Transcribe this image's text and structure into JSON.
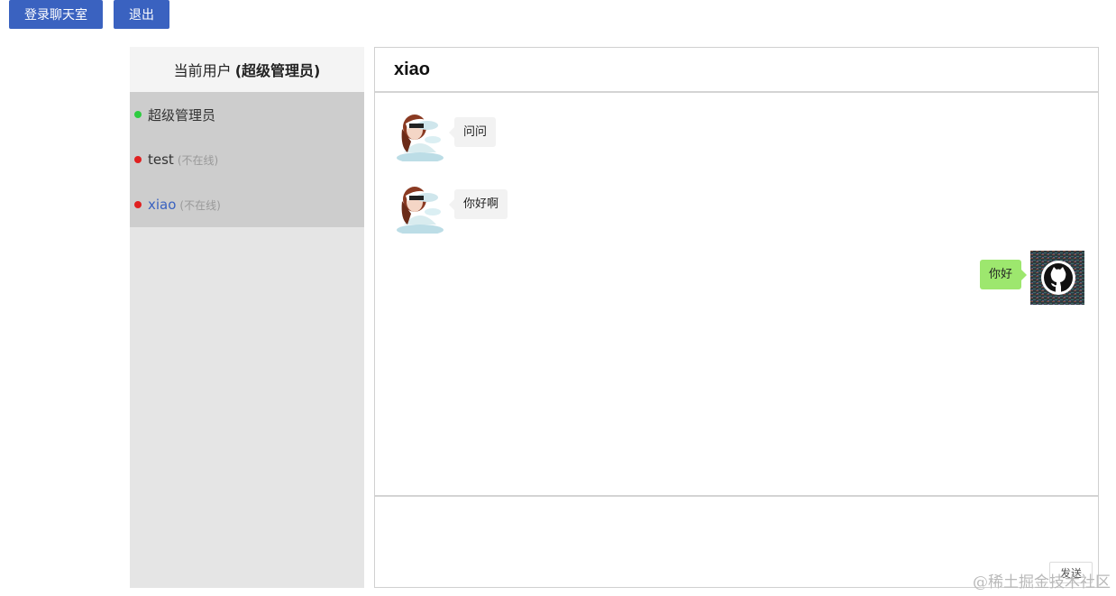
{
  "header": {
    "login_label": "登录聊天室",
    "logout_label": "退出"
  },
  "sidebar": {
    "current_user_prefix": "当前用户",
    "current_user_name": "(超级管理员)",
    "users": [
      {
        "name": "超级管理员",
        "status": "",
        "online": true
      },
      {
        "name": "test",
        "status": "(不在线)",
        "online": false
      },
      {
        "name": "xiao",
        "status": "(不在线)",
        "online": false
      }
    ]
  },
  "chat": {
    "title": "xiao",
    "messages": [
      {
        "from": "other",
        "text": "问问",
        "avatar": "girl-avatar-icon"
      },
      {
        "from": "other",
        "text": "你好啊",
        "avatar": "girl-avatar-icon"
      },
      {
        "from": "self",
        "text": "你好",
        "avatar": "github-avatar-icon"
      }
    ],
    "input_value": "",
    "send_label": "发送"
  },
  "watermark": "@稀土掘金技术社区",
  "colors": {
    "primary": "#3a62c0",
    "online": "#2ecc40",
    "offline": "#e02020",
    "self_bubble": "#9de76e",
    "other_bubble": "#f2f2f2"
  }
}
